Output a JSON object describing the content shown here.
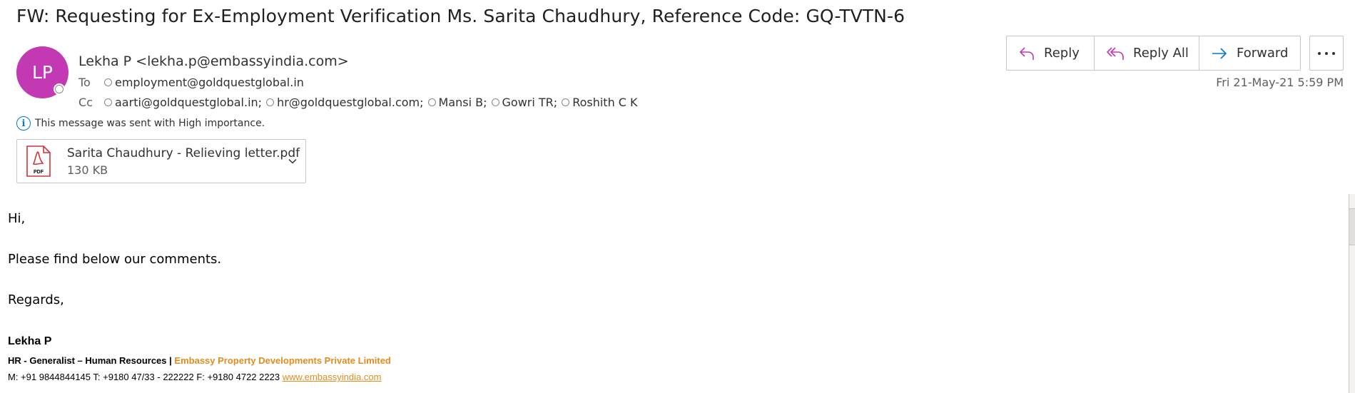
{
  "email": {
    "subject": "FW: Requesting for Ex-Employment Verification Ms. Sarita Chaudhury, Reference Code: GQ-TVTN-6",
    "sender": {
      "initials": "LP",
      "display": "Lekha P <lekha.p@embassyindia.com>",
      "avatar_color": "#c239b3"
    },
    "to_label": "To",
    "cc_label": "Cc",
    "to": [
      "employment@goldquestglobal.in"
    ],
    "cc": [
      "aarti@goldquestglobal.in;",
      "hr@goldquestglobal.com;",
      "Mansi B;",
      "Gowri TR;",
      "Roshith C K"
    ],
    "importance_note": "This message was sent with High importance.",
    "date": "Fri 21-May-21 5:59 PM",
    "attachment": {
      "name": "Sarita Chaudhury - Relieving letter.pdf",
      "size": "130 KB",
      "icon_label": "PDF"
    }
  },
  "actions": {
    "reply": "Reply",
    "reply_all": "Reply All",
    "forward": "Forward"
  },
  "body": {
    "greeting": "Hi,",
    "line1": "Please find below our comments.",
    "closing": "Regards,"
  },
  "signature": {
    "name": "Lekha P",
    "title": "HR - Generalist – Human Resources",
    "separator": "|",
    "company": "Embassy Property Developments Private Limited",
    "contact": "M: +91 9844844145 T: +9180 47/33 - 222222 F: +9180 4722 2223",
    "website": "www.embassyindia.com"
  },
  "colors": {
    "accent": "#0078d4",
    "reply_all_icon": "#c239b3",
    "signature_orange": "#e48b1c"
  }
}
